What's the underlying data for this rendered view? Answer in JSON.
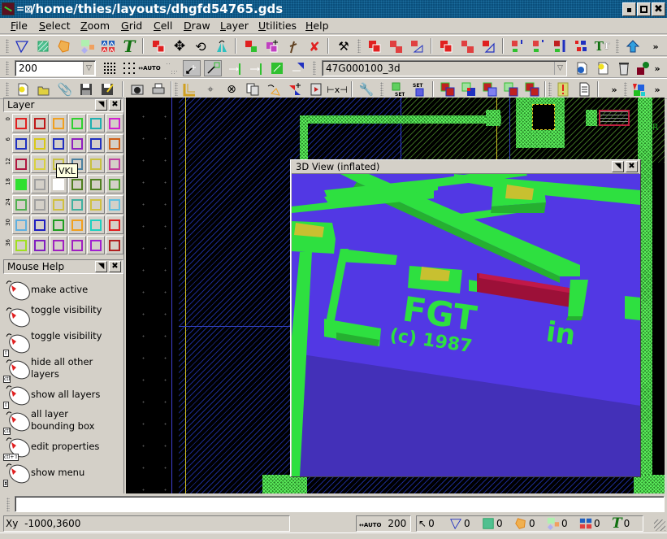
{
  "window": {
    "title": "/home/thies/layouts/dhgfd54765.gds",
    "buttons": [
      "minimize",
      "maximize",
      "close"
    ]
  },
  "menu": [
    {
      "label": "File",
      "mnemonic": "F"
    },
    {
      "label": "Select",
      "mnemonic": "S"
    },
    {
      "label": "Zoom",
      "mnemonic": "Z"
    },
    {
      "label": "Grid",
      "mnemonic": "G"
    },
    {
      "label": "Cell",
      "mnemonic": "C"
    },
    {
      "label": "Draw",
      "mnemonic": "D"
    },
    {
      "label": "Layer",
      "mnemonic": "L"
    },
    {
      "label": "Utilities",
      "mnemonic": "U"
    },
    {
      "label": "Help",
      "mnemonic": "H"
    }
  ],
  "toolbar1": {
    "icons": [
      "polygon-icon",
      "box-icon",
      "polygon-fill-icon",
      "path-icon",
      "cell-ref-icon",
      "text-icon",
      "copy-icon",
      "move-icon",
      "rotate-icon",
      "mirror-icon",
      "duplicate-icon",
      "merge-icon",
      "cut-icon",
      "delete-icon",
      "hammer-icon",
      "boolean-and-icon",
      "boolean-or-icon",
      "boolean-size-icon",
      "boolean-xor-icon",
      "boolean-sub-icon",
      "boolean-grow-icon",
      "density-a-icon",
      "density-b-icon",
      "density-c-icon",
      "fill-box-icon",
      "text-convert-icon",
      "up-arrow-icon",
      "more-icon"
    ]
  },
  "toolbar2": {
    "grid_value": "200",
    "cell_name": "47G000100_3d",
    "icons": [
      "grid-fine-icon",
      "grid-coarse-icon",
      "grid-auto-icon",
      "grid-off-icon",
      "snap-point-icon",
      "snap-edge-icon",
      "snap-right-icon",
      "snap-left-icon",
      "snap-area-icon",
      "snap-hatch-icon",
      "cell-info-icon",
      "new-cell-icon",
      "delete-cell-icon",
      "cell-tree-icon",
      "more-icon"
    ]
  },
  "toolbar3": {
    "icons": [
      "new-file-icon",
      "open-file-icon",
      "attach-icon",
      "save-icon",
      "save-as-icon",
      "screenshot-icon",
      "print-icon",
      "ruler-icon",
      "origin-icon",
      "center-icon",
      "copy-page-icon",
      "rotate-tool-icon",
      "flip-icon",
      "movie-icon",
      "measure-icon",
      "settings-wrench-icon",
      "set-layer-a-icon",
      "set-layer-b-icon",
      "layer-op1-icon",
      "layer-op2-icon",
      "layer-op3-icon",
      "layer-op4-icon",
      "layer-op5-icon",
      "drc-icon",
      "report-icon",
      "more-icon",
      "3d-icon",
      "more-icon"
    ]
  },
  "layer_panel": {
    "title": "Layer",
    "row_labels": [
      "0",
      "6",
      "12",
      "18",
      "24",
      "30",
      "36"
    ],
    "tooltip": "VKL",
    "colors": [
      [
        "#e02020",
        "#c01818",
        "#f0a020",
        "#30d030",
        "#20b0b0",
        "#d020d0"
      ],
      [
        "#2030c0",
        "#d8c818",
        "#2030c0",
        "#9020c0",
        "#2030c0",
        "#d06018"
      ],
      [
        "#b01840",
        "#d8d040",
        "#c8c040",
        "#4a80a0",
        "#c8c040",
        "#c040a0"
      ],
      [
        "#30e030",
        "#a0a0a0",
        "#ffffff",
        "#508020",
        "#508020",
        "#50a030"
      ],
      [
        "#50b050",
        "#a0a0a0",
        "#d0c040",
        "#40b0a0",
        "#d0c040",
        "#60c0e0"
      ],
      [
        "#60b0e0",
        "#2020c0",
        "#20a020",
        "#f0a020",
        "#20d0c0",
        "#e02020"
      ],
      [
        "#a0e020",
        "#8020c0",
        "#a020c0",
        "#a020c0",
        "#a020d0",
        "#b02020"
      ]
    ]
  },
  "mouse_help": {
    "title": "Mouse Help",
    "items": [
      {
        "text": "make active",
        "modifier": ""
      },
      {
        "text": "toggle visibility",
        "modifier": ""
      },
      {
        "text": "toggle visibility",
        "modifier": "shift"
      },
      {
        "text": "hide all other layers",
        "modifier": "ctrl"
      },
      {
        "text": "show all layers",
        "modifier": "shift"
      },
      {
        "text": "all layer bounding box",
        "modifier": "ctrl"
      },
      {
        "text": "edit properties",
        "modifier": "ctrl+shift"
      },
      {
        "text": "show menu",
        "modifier": "hold"
      }
    ]
  },
  "view3d": {
    "title": "3D View (inflated)",
    "colors": {
      "background": "#5238e4",
      "floor": "#4330b8",
      "metal": "#2ee040",
      "metal_side": "#25b030",
      "via": "#c8c030",
      "poly": "#9c1038"
    }
  },
  "command_line": {
    "value": ""
  },
  "status": {
    "coordinates": "-1000,3600",
    "coord_label": "Xy",
    "grid": "200",
    "counts": [
      {
        "icon": "select-arrow-icon",
        "value": "0"
      },
      {
        "icon": "polygon-icon",
        "value": "0"
      },
      {
        "icon": "box-icon",
        "value": "0"
      },
      {
        "icon": "polygon-fill-icon",
        "value": "0"
      },
      {
        "icon": "path-icon",
        "value": "0"
      },
      {
        "icon": "cell-ref-icon",
        "value": "0"
      },
      {
        "icon": "text-icon",
        "value": "0"
      }
    ]
  }
}
